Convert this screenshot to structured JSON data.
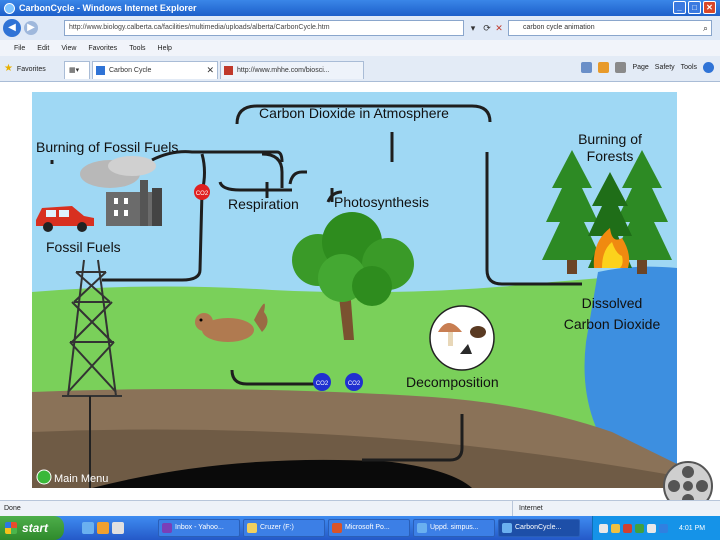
{
  "window": {
    "title": "CarbonCycle - Windows Internet Explorer"
  },
  "address": {
    "url": "http://www.biology.calberta.ca/facilities/multimedia/uploads/alberta/CarbonCycle.htm"
  },
  "search": {
    "value": "carbon cycle animation"
  },
  "menu": [
    "File",
    "Edit",
    "View",
    "Favorites",
    "Tools",
    "Help"
  ],
  "favorites": {
    "label": "Favorites"
  },
  "tabs": [
    {
      "label": "Carbon Cycle"
    },
    {
      "label": "http://www.mhhe.com/biosci..."
    }
  ],
  "toolbar": {
    "page": "Page",
    "safety": "Safety",
    "tools": "Tools"
  },
  "diagram": {
    "atmosphere": "Carbon Dioxide in Atmosphere",
    "burning_fossil": "Burning of Fossil Fuels",
    "burning_forests_1": "Burning of",
    "burning_forests_2": "Forests",
    "respiration": "Respiration",
    "photosynthesis": "Photosynthesis",
    "fossil_fuels": "Fossil Fuels",
    "dissolved_1": "Dissolved",
    "dissolved_2": "Carbon Dioxide",
    "decomposition": "Decomposition",
    "co2": "CO2",
    "main_menu": "Main Menu"
  },
  "status": {
    "left": "Done",
    "zone": "Internet"
  },
  "taskbar": {
    "start": "start",
    "buttons": [
      "Inbox - Yahoo...",
      "Cruzer (F:)",
      "Microsoft Po...",
      "Uppd. simpus...",
      "CarbonCycle..."
    ],
    "clock": "4:01 PM"
  }
}
